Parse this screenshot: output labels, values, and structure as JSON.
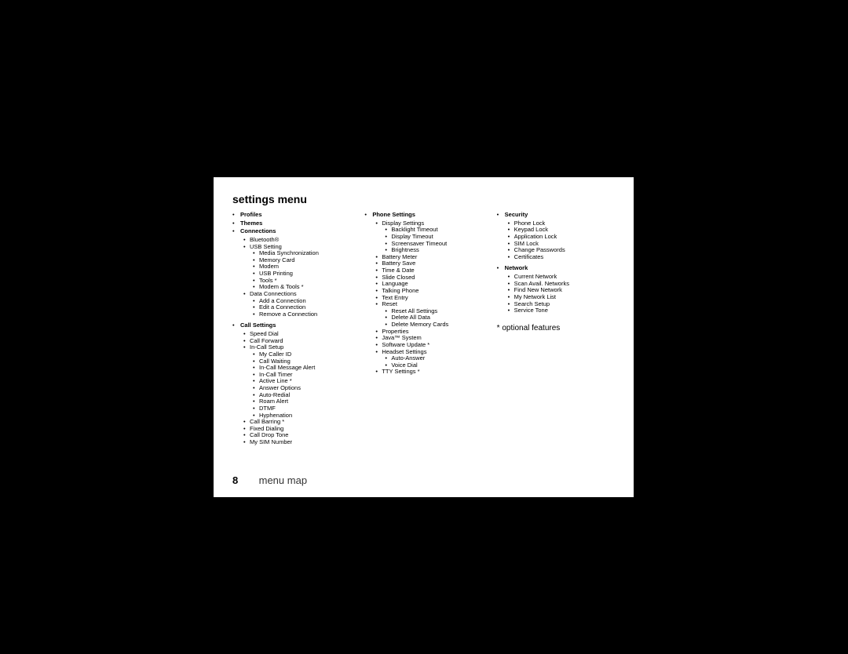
{
  "title": "settings menu",
  "optional_note": "* optional features",
  "footer": {
    "page": "8",
    "label": "menu map"
  },
  "col1": [
    {
      "title": "Profiles"
    },
    {
      "title": "Themes"
    },
    {
      "title": "Connections",
      "items": [
        {
          "label": "Bluetooth®"
        },
        {
          "label": "USB Setting",
          "items": [
            "Media Synchronization",
            "Memory Card",
            "Modem",
            "USB Printing",
            "Tools *",
            "Modem & Tools *"
          ]
        },
        {
          "label": "Data Connections",
          "items": [
            "Add a Connection",
            "Edit a Connection",
            "Remove a Connection"
          ]
        }
      ]
    },
    {
      "title": "Call Settings",
      "items": [
        {
          "label": "Speed Dial"
        },
        {
          "label": "Call Forward"
        },
        {
          "label": "In-Call Setup",
          "items": [
            "My Caller ID",
            "Call Waiting",
            "In-Call Message Alert",
            "In-Call Timer",
            "Active Line *",
            "Answer Options",
            "Auto-Redial",
            "Roam Alert",
            "DTMF",
            "Hyphenation"
          ]
        },
        {
          "label": "Call Barring *"
        },
        {
          "label": "Fixed Dialing"
        },
        {
          "label": "Call Drop Tone"
        },
        {
          "label": "My SIM Number"
        }
      ]
    }
  ],
  "col2": [
    {
      "title": "Phone Settings",
      "items": [
        {
          "label": "Display Settings",
          "items": [
            "Backlight Timeout",
            "Display Timeout",
            "Screensaver Timeout",
            "Brightness"
          ]
        },
        {
          "label": "Battery Meter"
        },
        {
          "label": "Battery Save"
        },
        {
          "label": "Time & Date"
        },
        {
          "label": "Slide Closed"
        },
        {
          "label": "Language"
        },
        {
          "label": "Talking Phone"
        },
        {
          "label": "Text Entry"
        },
        {
          "label": "Reset",
          "items": [
            "Reset All Settings",
            "Delete All Data",
            "Delete Memory Cards"
          ]
        },
        {
          "label": "Properties"
        },
        {
          "label": "Java™ System"
        },
        {
          "label": "Software Update *"
        },
        {
          "label": "Headset Settings",
          "items": [
            "Auto-Answer",
            "Voice Dial"
          ]
        },
        {
          "label": "TTY Settings *"
        }
      ]
    }
  ],
  "col3": [
    {
      "title": "Security",
      "items": [
        {
          "label": "Phone Lock"
        },
        {
          "label": "Keypad Lock"
        },
        {
          "label": "Application Lock"
        },
        {
          "label": "SIM Lock"
        },
        {
          "label": "Change Passwords"
        },
        {
          "label": "Certificates"
        }
      ]
    },
    {
      "title": "Network",
      "items": [
        {
          "label": "Current Network"
        },
        {
          "label": "Scan Avail. Networks"
        },
        {
          "label": "Find New Network"
        },
        {
          "label": "My Network List"
        },
        {
          "label": "Search Setup"
        },
        {
          "label": "Service Tone"
        }
      ]
    }
  ]
}
